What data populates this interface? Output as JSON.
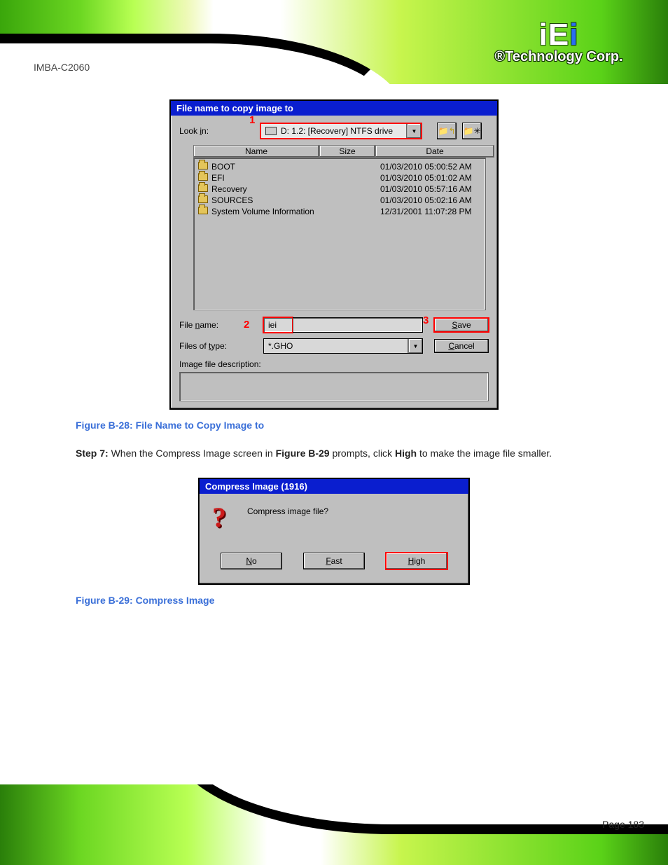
{
  "header": {
    "logo_text": "iEi",
    "logo_subtitle": "®Technology Corp.",
    "product": "IMBA-C2060"
  },
  "dialog1": {
    "title": "File name to copy image to",
    "look_in_label": "Look in:",
    "look_in_value": "D: 1.2: [Recovery] NTFS drive",
    "columns": {
      "name": "Name",
      "size": "Size",
      "date": "Date"
    },
    "rows": [
      {
        "name": "BOOT",
        "size": "",
        "date": "01/03/2010 05:00:52 AM"
      },
      {
        "name": "EFI",
        "size": "",
        "date": "01/03/2010 05:01:02 AM"
      },
      {
        "name": "Recovery",
        "size": "",
        "date": "01/03/2010 05:57:16 AM"
      },
      {
        "name": "SOURCES",
        "size": "",
        "date": "01/03/2010 05:02:16 AM"
      },
      {
        "name": "System Volume Information",
        "size": "",
        "date": "12/31/2001 11:07:28 PM"
      }
    ],
    "file_name_label": "File name:",
    "file_name_value": "iei",
    "files_of_type_label": "Files of type:",
    "files_of_type_value": "*.GHO",
    "image_desc_label": "Image file description:",
    "save_label": "Save",
    "cancel_label": "Cancel",
    "callouts": {
      "c1": "1",
      "c2": "2",
      "c3": "3"
    }
  },
  "caption1": "Figure B-28: File Name to Copy Image to",
  "step7_full": "Step 7:  When the Compress Image screen in Figure B-29 prompts, click High to make the image file smaller.",
  "dialog2": {
    "title": "Compress Image (1916)",
    "question": "Compress image file?",
    "no_label": "No",
    "fast_label": "Fast",
    "high_label": "High"
  },
  "caption2": "Figure B-29: Compress Image",
  "page_number": "Page 183"
}
